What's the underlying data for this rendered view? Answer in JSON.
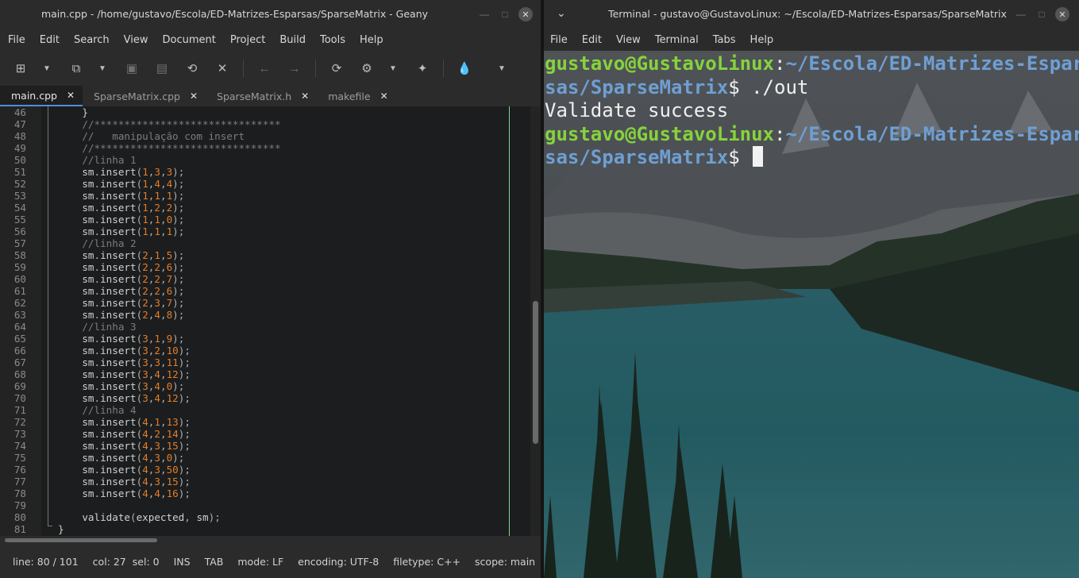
{
  "geany": {
    "title": "main.cpp - /home/gustavo/Escola/ED-Matrizes-Esparsas/SparseMatrix - Geany",
    "menu": [
      "File",
      "Edit",
      "Search",
      "View",
      "Document",
      "Project",
      "Build",
      "Tools",
      "Help"
    ],
    "toolbar_icons": [
      "new-file-icon",
      "dropdown-icon",
      "open-file-icon",
      "dropdown-icon",
      "save-icon",
      "save-all-icon",
      "revert-icon",
      "close-icon",
      "back-icon",
      "forward-icon",
      "reload-icon",
      "build-gear-icon",
      "dropdown-icon",
      "execute-icon",
      "color-picker-icon",
      "dropdown-icon"
    ],
    "tabs": [
      {
        "label": "main.cpp",
        "active": true
      },
      {
        "label": "SparseMatrix.cpp",
        "active": false
      },
      {
        "label": "SparseMatrix.h",
        "active": false
      },
      {
        "label": "makefile",
        "active": false
      }
    ],
    "code_lines": [
      {
        "n": "46",
        "t": "    }"
      },
      {
        "n": "47",
        "t": "    //*******************************"
      },
      {
        "n": "48",
        "t": "    //   manipulação com insert"
      },
      {
        "n": "49",
        "t": "    //*******************************"
      },
      {
        "n": "50",
        "t": "    //linha 1"
      },
      {
        "n": "51",
        "t": "    sm.insert(1,3,3);"
      },
      {
        "n": "52",
        "t": "    sm.insert(1,4,4);"
      },
      {
        "n": "53",
        "t": "    sm.insert(1,1,1);"
      },
      {
        "n": "54",
        "t": "    sm.insert(1,2,2);"
      },
      {
        "n": "55",
        "t": "    sm.insert(1,1,0);"
      },
      {
        "n": "56",
        "t": "    sm.insert(1,1,1);"
      },
      {
        "n": "57",
        "t": "    //linha 2"
      },
      {
        "n": "58",
        "t": "    sm.insert(2,1,5);"
      },
      {
        "n": "59",
        "t": "    sm.insert(2,2,6);"
      },
      {
        "n": "60",
        "t": "    sm.insert(2,2,7);"
      },
      {
        "n": "61",
        "t": "    sm.insert(2,2,6);"
      },
      {
        "n": "62",
        "t": "    sm.insert(2,3,7);"
      },
      {
        "n": "63",
        "t": "    sm.insert(2,4,8);"
      },
      {
        "n": "64",
        "t": "    //linha 3"
      },
      {
        "n": "65",
        "t": "    sm.insert(3,1,9);"
      },
      {
        "n": "66",
        "t": "    sm.insert(3,2,10);"
      },
      {
        "n": "67",
        "t": "    sm.insert(3,3,11);"
      },
      {
        "n": "68",
        "t": "    sm.insert(3,4,12);"
      },
      {
        "n": "69",
        "t": "    sm.insert(3,4,0);"
      },
      {
        "n": "70",
        "t": "    sm.insert(3,4,12);"
      },
      {
        "n": "71",
        "t": "    //linha 4"
      },
      {
        "n": "72",
        "t": "    sm.insert(4,1,13);"
      },
      {
        "n": "73",
        "t": "    sm.insert(4,2,14);"
      },
      {
        "n": "74",
        "t": "    sm.insert(4,3,15);"
      },
      {
        "n": "75",
        "t": "    sm.insert(4,3,0);"
      },
      {
        "n": "76",
        "t": "    sm.insert(4,3,50);"
      },
      {
        "n": "77",
        "t": "    sm.insert(4,3,15);"
      },
      {
        "n": "78",
        "t": "    sm.insert(4,4,16);"
      },
      {
        "n": "79",
        "t": ""
      },
      {
        "n": "80",
        "t": "    validate(expected, sm);"
      },
      {
        "n": "81",
        "t": "}"
      }
    ],
    "status": {
      "line": "line: 80 / 101",
      "col": "col: 27",
      "sel": "sel: 0",
      "ins": "INS",
      "tab": "TAB",
      "mode": "mode: LF",
      "encoding": "encoding: UTF-8",
      "filetype": "filetype: C++",
      "scope": "scope: main"
    }
  },
  "terminal": {
    "title": "Terminal - gustavo@GustavoLinux: ~/Escola/ED-Matrizes-Esparsas/SparseMatrix",
    "menu": [
      "File",
      "Edit",
      "View",
      "Terminal",
      "Tabs",
      "Help"
    ],
    "prompt_user": "gustavo@GustavoLinux",
    "prompt_sep": ":",
    "prompt_path_1": "~/Escola/ED-Matrizes-Espar",
    "prompt_path_2": "sas/SparseMatrix",
    "prompt_dollar": "$",
    "command": " ./out",
    "output": "Validate success"
  },
  "colors": {
    "prompt_user": "#86d33c",
    "prompt_path": "#6f9fd3",
    "number_literal": "#e37d28",
    "comment": "#7d7d7d",
    "edge_line": "#7fd98b"
  }
}
